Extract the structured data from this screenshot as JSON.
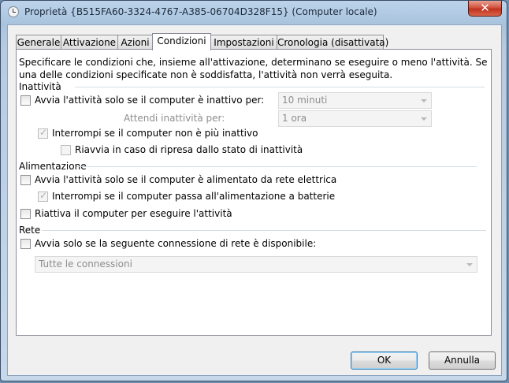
{
  "window": {
    "title": "Proprietà {B515FA60-3324-4767-A385-06704D328F15} (Computer locale)",
    "close_glyph": "✕"
  },
  "tabs": [
    {
      "label": "Generale"
    },
    {
      "label": "Attivazione"
    },
    {
      "label": "Azioni"
    },
    {
      "label": "Condizioni"
    },
    {
      "label": "Impostazioni"
    },
    {
      "label": "Cronologia (disattivata)"
    }
  ],
  "description": "Specificare le condizioni che, insieme all'attivazione, determinano se eseguire o meno l'attività. Se una delle condizioni specificate non è soddisfatta, l'attività non verrà eseguita.",
  "idle": {
    "group": "Inattività",
    "start_if_idle": "Avvia l'attività solo se il computer è inattivo per:",
    "idle_duration": "10 minuti",
    "wait_label": "Attendi inattività per:",
    "wait_duration": "1 ora",
    "stop_if_not_idle": "Interrompi se il computer non è più inattivo",
    "restart_if_idle_resumes": "Riavvia in caso di ripresa dallo stato di inattività"
  },
  "power": {
    "group": "Alimentazione",
    "ac_only": "Avvia l'attività solo se il computer è alimentato da rete elettrica",
    "stop_on_battery": "Interrompi se il computer passa all'alimentazione a batterie",
    "wake_to_run": "Riattiva il computer per eseguire l'attività"
  },
  "network": {
    "group": "Rete",
    "start_if_network": "Avvia solo se la seguente connessione di rete è disponibile:",
    "connection": "Tutte le connessioni"
  },
  "buttons": {
    "ok": "OK",
    "cancel": "Annulla"
  }
}
